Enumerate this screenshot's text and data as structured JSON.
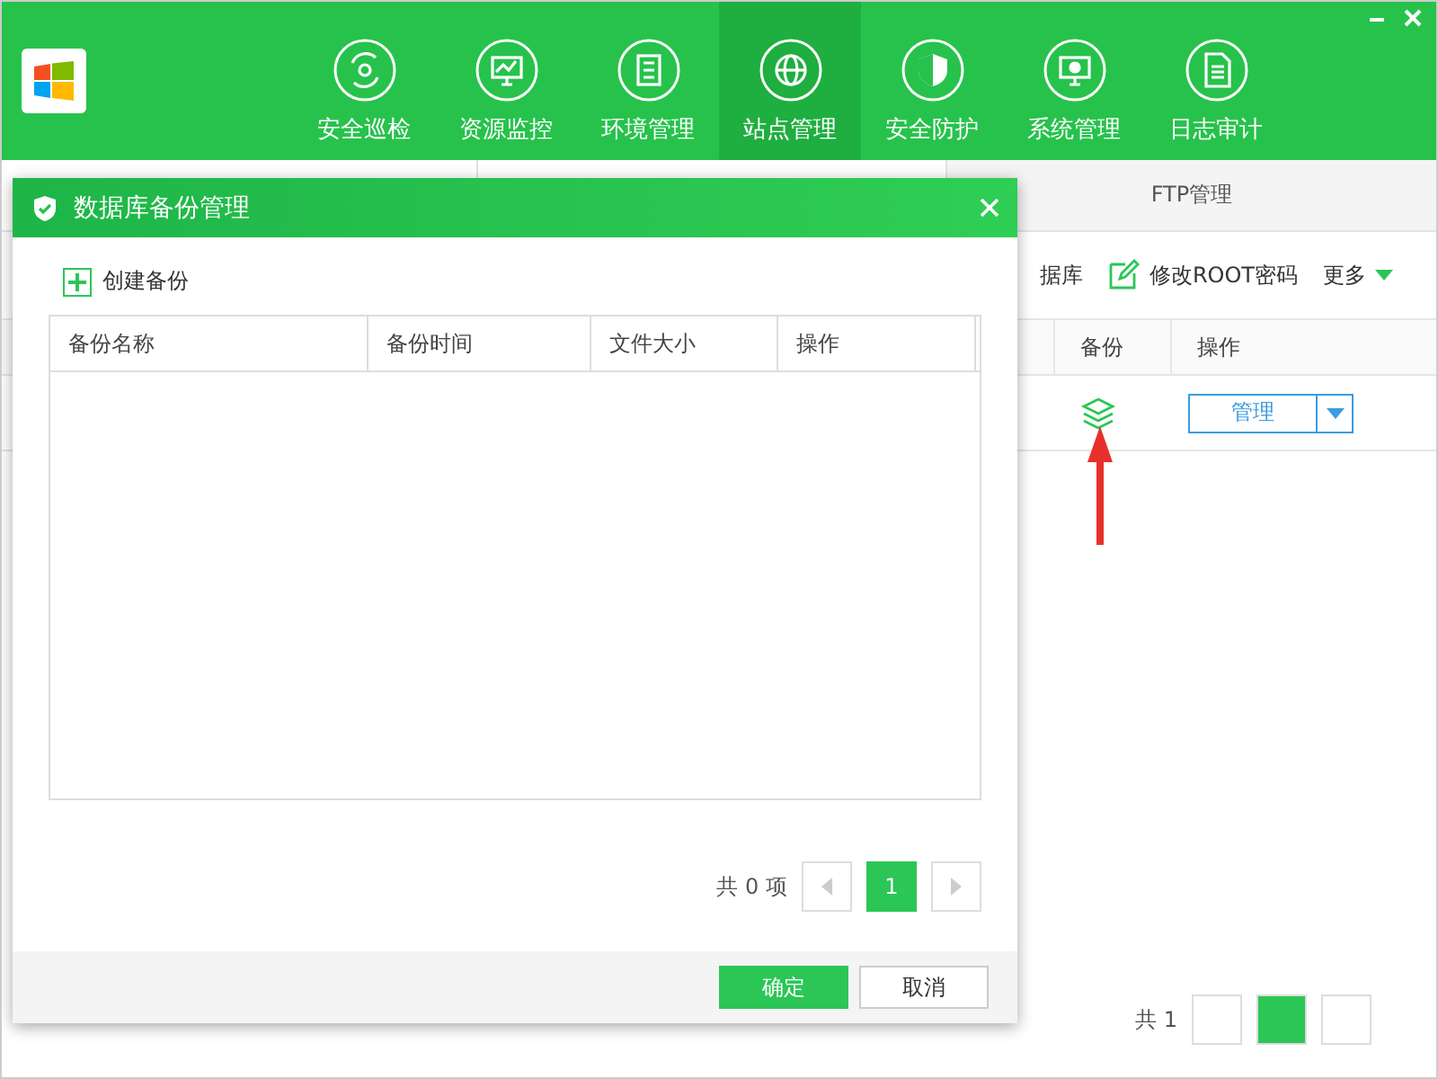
{
  "nav": [
    {
      "label": "安全巡检",
      "selected": false
    },
    {
      "label": "资源监控",
      "selected": false
    },
    {
      "label": "环境管理",
      "selected": false
    },
    {
      "label": "站点管理",
      "selected": true
    },
    {
      "label": "安全防护",
      "selected": false
    },
    {
      "label": "系统管理",
      "selected": false
    },
    {
      "label": "日志审计",
      "selected": false
    }
  ],
  "background": {
    "tabs": [
      {
        "label": "FTP管理"
      }
    ],
    "toolbar": [
      {
        "label": "据库",
        "kind": "text"
      },
      {
        "label": "修改ROOT密码",
        "kind": "edit"
      },
      {
        "label": "更多",
        "kind": "more"
      }
    ],
    "columns": [
      "备份",
      "操作"
    ],
    "row": {
      "manage": "管理"
    },
    "total": "共 1"
  },
  "dialog": {
    "title": "数据库备份管理",
    "create": "创建备份",
    "columns": [
      "备份名称",
      "备份时间",
      "文件大小",
      "操作"
    ],
    "total": "共 0 项",
    "pages": [
      {
        "label": "1",
        "selected": true
      }
    ],
    "buttons": [
      {
        "label": "确定",
        "kind": "primary"
      },
      {
        "label": "取消",
        "kind": "secondary"
      }
    ]
  }
}
